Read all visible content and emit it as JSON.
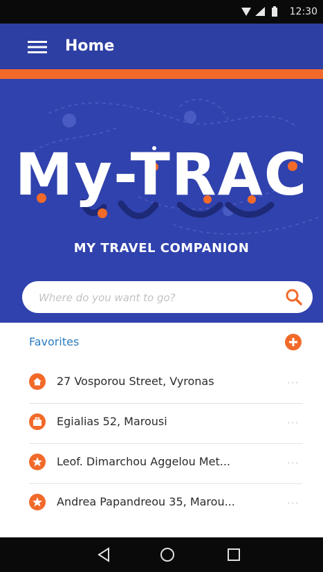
{
  "status_bar": {
    "time": "12:30"
  },
  "app_bar": {
    "title": "Home"
  },
  "hero": {
    "logo_text": "My-TRAC",
    "tagline": "MY TRAVEL COMPANION",
    "search": {
      "placeholder": "Where do you want to go?"
    }
  },
  "favorites": {
    "header": "Favorites",
    "items": [
      {
        "label": "27 Vosporou Street, Vyronas",
        "icon": "home-icon"
      },
      {
        "label": "Egialias 52, Marousi",
        "icon": "work-icon"
      },
      {
        "label": "Leof. Dimarchou Aggelou Met...",
        "icon": "star-icon"
      },
      {
        "label": "Andrea Papandreou 35, Marou...",
        "icon": "star-icon"
      }
    ],
    "more_glyph": "···"
  },
  "colors": {
    "primary": "#2e3fa3",
    "accent": "#f26a2a",
    "favorites_header": "#2a7bbf"
  }
}
